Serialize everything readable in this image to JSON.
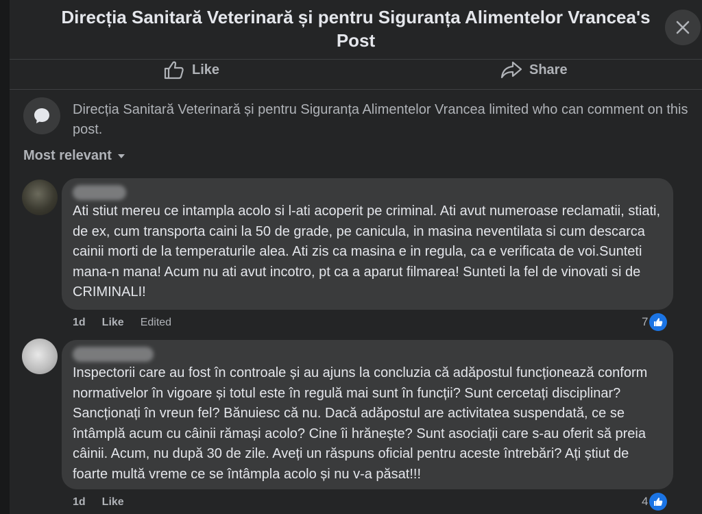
{
  "header": {
    "title": "Direcția Sanitară Veterinară și pentru Siguranța Alimentelor Vrancea's Post",
    "close_icon": "close-icon"
  },
  "actions": {
    "like_label": "Like",
    "share_label": "Share"
  },
  "notice": {
    "text": "Direcția Sanitară Veterinară și pentru Siguranța Alimentelor Vrancea limited who can comment on this post."
  },
  "sort": {
    "label": "Most relevant"
  },
  "comments": [
    {
      "text": "Ati stiut mereu ce intampla acolo si l-ati acoperit pe criminal. Ati avut numeroase reclamatii, stiati, de ex, cum transporta caini la 50 de grade, pe canicula, in masina neventilata si cum descarca cainii morti de la temperaturile alea. Ati zis ca masina e in regula, ca e verificata de voi.Sunteti mana-n mana! Acum nu ati avut incotro, pt ca a aparut filmarea! Sunteti la fel de vinovati si de CRIMINALI!",
      "time": "1d",
      "like_label": "Like",
      "edited": "Edited",
      "reaction_count": "7"
    },
    {
      "text": "Inspectorii care au fost în controale și au ajuns la concluzia că adăpostul funcționează conform normativelor în vigoare și totul este în regulă mai sunt în funcții? Sunt cercetați disciplinar? Sancționați în vreun fel? Bănuiesc că nu. Dacă adăpostul are activitatea suspendată, ce se întâmplă acum cu câinii rămași acolo? Cine îi hrănește? Sunt asociații care s-au oferit să preia câinii. Acum, nu după 30 de zile. Aveți un răspuns oficial pentru aceste întrebări? Ați știut de foarte multă vreme ce se întâmpla acolo și nu v-a păsat!!!",
      "time": "1d",
      "like_label": "Like",
      "reaction_count": "4"
    }
  ],
  "colors": {
    "background": "#242526",
    "bubble": "#3a3b3c",
    "accent": "#1b74e4"
  }
}
